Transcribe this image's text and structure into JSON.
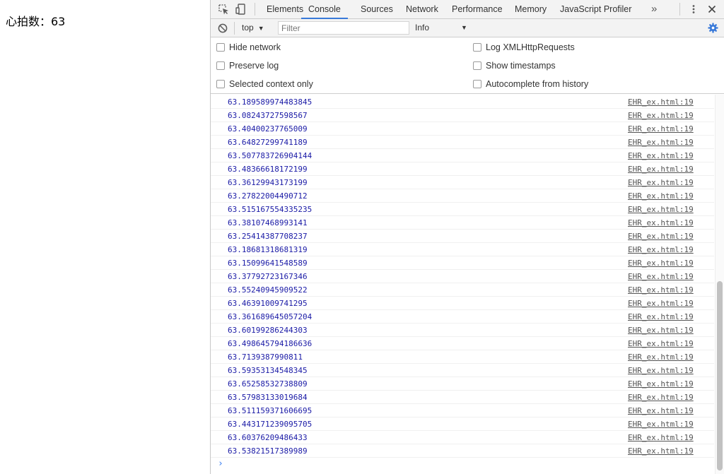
{
  "page": {
    "heartbeat_text": "心拍数：63"
  },
  "devtools": {
    "tabs": [
      {
        "label": "Elements",
        "active": false
      },
      {
        "label": "Console",
        "active": true
      },
      {
        "label": "Sources",
        "active": false
      },
      {
        "label": "Network",
        "active": false
      },
      {
        "label": "Performance",
        "active": false
      },
      {
        "label": "Memory",
        "active": false
      },
      {
        "label": "JavaScript Profiler",
        "active": false
      }
    ],
    "more_tabs": "»",
    "toolbar": {
      "context": "top",
      "filter_placeholder": "Filter",
      "filter_value": "",
      "level": "Info"
    },
    "settings": {
      "hide_network": "Hide network",
      "preserve_log": "Preserve log",
      "selected_context_only": "Selected context only",
      "log_xhr": "Log XMLHttpRequests",
      "show_timestamps": "Show timestamps",
      "autocomplete_history": "Autocomplete from history"
    },
    "messages": [
      {
        "value": "63.189589974483845",
        "source": "EHR_ex.html:19"
      },
      {
        "value": "63.08243727598567",
        "source": "EHR_ex.html:19"
      },
      {
        "value": "63.40400237765009",
        "source": "EHR_ex.html:19"
      },
      {
        "value": "63.64827299741189",
        "source": "EHR_ex.html:19"
      },
      {
        "value": "63.507783726904144",
        "source": "EHR_ex.html:19"
      },
      {
        "value": "63.48366618172199",
        "source": "EHR_ex.html:19"
      },
      {
        "value": "63.36129943173199",
        "source": "EHR_ex.html:19"
      },
      {
        "value": "63.27822004490712",
        "source": "EHR_ex.html:19"
      },
      {
        "value": "63.515167554335235",
        "source": "EHR_ex.html:19"
      },
      {
        "value": "63.38107468993141",
        "source": "EHR_ex.html:19"
      },
      {
        "value": "63.25414387708237",
        "source": "EHR_ex.html:19"
      },
      {
        "value": "63.18681318681319",
        "source": "EHR_ex.html:19"
      },
      {
        "value": "63.15099641548589",
        "source": "EHR_ex.html:19"
      },
      {
        "value": "63.37792723167346",
        "source": "EHR_ex.html:19"
      },
      {
        "value": "63.55240945909522",
        "source": "EHR_ex.html:19"
      },
      {
        "value": "63.46391009741295",
        "source": "EHR_ex.html:19"
      },
      {
        "value": "63.361689645057204",
        "source": "EHR_ex.html:19"
      },
      {
        "value": "63.60199286244303",
        "source": "EHR_ex.html:19"
      },
      {
        "value": "63.498645794186636",
        "source": "EHR_ex.html:19"
      },
      {
        "value": "63.7139387990811",
        "source": "EHR_ex.html:19"
      },
      {
        "value": "63.59353134548345",
        "source": "EHR_ex.html:19"
      },
      {
        "value": "63.65258532738809",
        "source": "EHR_ex.html:19"
      },
      {
        "value": "63.57983133019684",
        "source": "EHR_ex.html:19"
      },
      {
        "value": "63.511159371606695",
        "source": "EHR_ex.html:19"
      },
      {
        "value": "63.443171239095705",
        "source": "EHR_ex.html:19"
      },
      {
        "value": "63.60376209486433",
        "source": "EHR_ex.html:19"
      },
      {
        "value": "63.53821517389989",
        "source": "EHR_ex.html:19"
      }
    ],
    "prompt": "›"
  },
  "colors": {
    "accent": "#3879d9",
    "value_text": "#1a1aa6",
    "settings_icon": "#3879d9"
  }
}
